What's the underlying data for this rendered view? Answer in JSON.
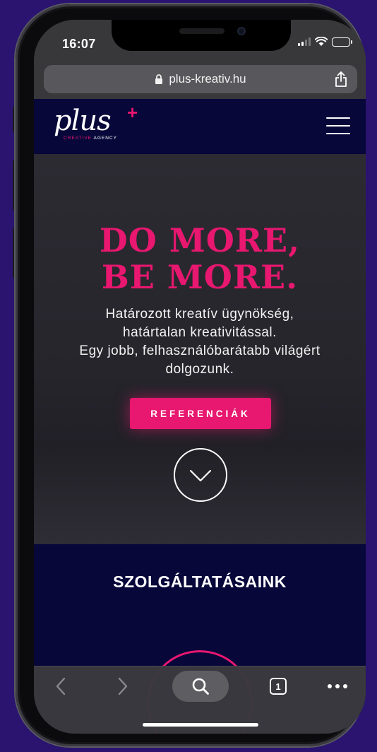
{
  "status_bar": {
    "time": "16:07"
  },
  "browser": {
    "url": "plus-kreativ.hu",
    "tabs_count": "1"
  },
  "site": {
    "logo": {
      "script": "plus",
      "plus_sign": "+",
      "sub_pink": "CREATIVE",
      "sub_white": " AGENCY"
    },
    "hero": {
      "headline_line1": "DO MORE,",
      "headline_line2": "BE MORE.",
      "text_lines": [
        "Határozott kreatív ügynökség,",
        "határtalan kreativitással.",
        "Egy jobb, felhasználóbarátabb világért",
        "dolgozunk."
      ],
      "cta_label": "REFERENCIÁK"
    },
    "services": {
      "title": "SZOLGÁLTATÁSAINK"
    }
  },
  "colors": {
    "brand_pink": "#e8176f",
    "navy": "#07073a",
    "background": "#2a1470"
  },
  "icons": [
    "lock-icon",
    "share-icon",
    "menu-icon",
    "chevron-down-icon",
    "back-icon",
    "forward-icon",
    "search-icon",
    "tabs-icon",
    "more-icon",
    "signal-icon",
    "wifi-icon",
    "battery-icon"
  ]
}
